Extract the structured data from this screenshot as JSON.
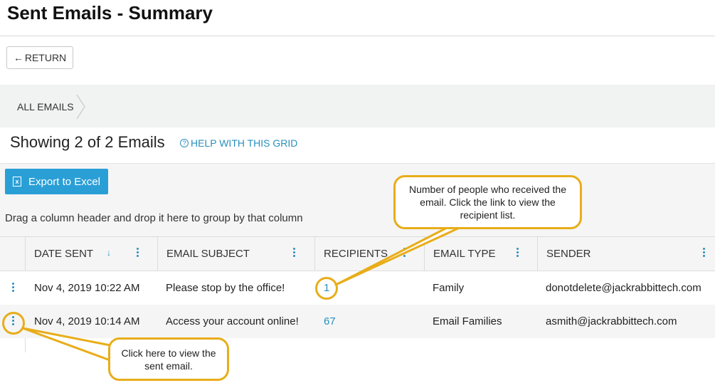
{
  "page": {
    "title": "Sent Emails - Summary"
  },
  "toolbar": {
    "return_label": "RETURN"
  },
  "breadcrumb": {
    "item": "ALL EMAILS"
  },
  "summary": {
    "showing": "Showing 2 of 2 Emails",
    "help": "HELP WITH THIS GRID"
  },
  "export": {
    "label": "Export to Excel",
    "icon": "x"
  },
  "group": {
    "hint": "Drag a column header and drop it here to group by that column"
  },
  "grid": {
    "columns": [
      "DATE SENT",
      "EMAIL SUBJECT",
      "RECIPIENTS",
      "EMAIL TYPE",
      "SENDER"
    ],
    "rows": [
      {
        "date": "Nov 4, 2019 10:22 AM",
        "subject": "Please stop by the office!",
        "recipients": "1",
        "type": "Family",
        "sender": "donotdelete@jackrabbittech.com"
      },
      {
        "date": "Nov 4, 2019 10:14 AM",
        "subject": "Access your account online!",
        "recipients": "67",
        "type": "Email Families",
        "sender": "asmith@jackrabbittech.com"
      }
    ]
  },
  "callouts": {
    "recipients": "Number of people who received the email. Click the link to view the recipient list.",
    "row_menu": "Click here to view the sent email."
  },
  "colors": {
    "accent": "#2a8fbd",
    "export_button": "#2a9fd6",
    "callout_border": "#e8ad1a"
  }
}
